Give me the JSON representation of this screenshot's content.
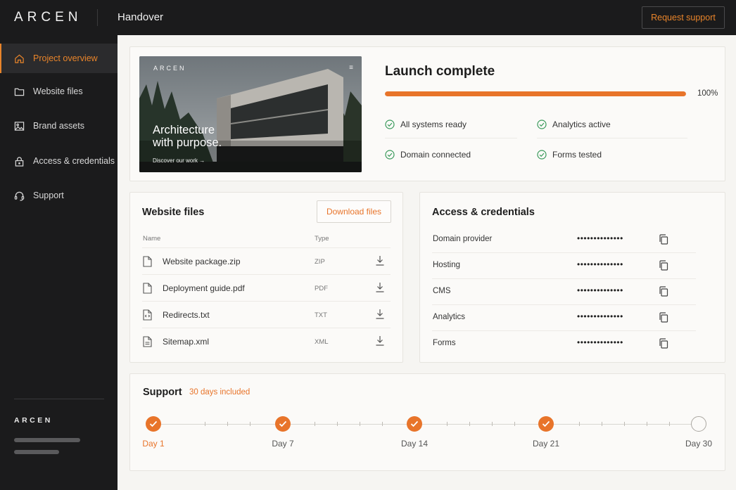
{
  "header": {
    "logo": "ARCEN",
    "title": "Handover",
    "request_support": "Request support"
  },
  "sidebar": {
    "items": [
      {
        "label": "Project overview",
        "icon": "home-icon",
        "active": true
      },
      {
        "label": "Website files",
        "icon": "folder-icon",
        "active": false
      },
      {
        "label": "Brand assets",
        "icon": "image-icon",
        "active": false
      },
      {
        "label": "Access & credentials",
        "icon": "lock-icon",
        "active": false
      },
      {
        "label": "Support",
        "icon": "headset-icon",
        "active": false
      }
    ],
    "footer_logo": "ARCEN"
  },
  "hero": {
    "logo": "ARCEN",
    "headline_line1": "Architecture",
    "headline_line2": "with purpose.",
    "link": "Discover our work →"
  },
  "launch": {
    "title": "Launch complete",
    "progress": 1.0,
    "progress_label": "100%",
    "checks": [
      "All systems ready",
      "Analytics active",
      "Domain connected",
      "Forms tested"
    ],
    "accent_color": "#e8742a",
    "check_color": "#3a9a5b"
  },
  "files": {
    "title": "Website files",
    "download_label": "Download files",
    "col_name": "Name",
    "col_type": "Type",
    "rows": [
      {
        "name": "Website package.zip",
        "type": "ZIP",
        "icon": "file-icon"
      },
      {
        "name": "Deployment guide.pdf",
        "type": "PDF",
        "icon": "file-icon"
      },
      {
        "name": "Redirects.txt",
        "type": "TXT",
        "icon": "code-file-icon"
      },
      {
        "name": "Sitemap.xml",
        "type": "XML",
        "icon": "doc-file-icon"
      }
    ]
  },
  "access": {
    "title": "Access & credentials",
    "rows": [
      {
        "name": "Domain provider",
        "masked": "••••••••••••••"
      },
      {
        "name": "Hosting",
        "masked": "••••••••••••••"
      },
      {
        "name": "CMS",
        "masked": "••••••••••••••"
      },
      {
        "name": "Analytics",
        "masked": "••••••••••••••"
      },
      {
        "name": "Forms",
        "masked": "••••••••••••••"
      }
    ]
  },
  "support": {
    "title": "Support",
    "subtitle": "30 days included",
    "milestones": [
      {
        "label": "Day 1",
        "done": true
      },
      {
        "label": "Day 7",
        "done": true
      },
      {
        "label": "Day 14",
        "done": true
      },
      {
        "label": "Day 21",
        "done": true
      },
      {
        "label": "Day 30",
        "done": false
      }
    ]
  }
}
